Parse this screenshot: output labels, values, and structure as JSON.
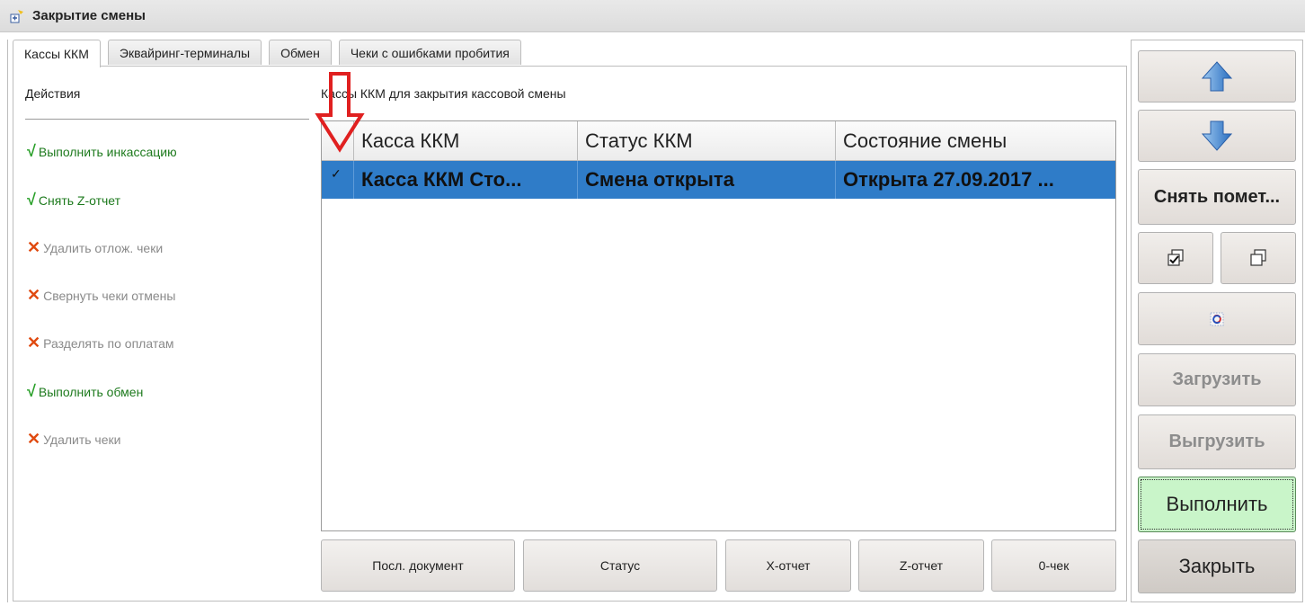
{
  "window": {
    "title": "Закрытие смены"
  },
  "tabs": [
    {
      "label": "Кассы ККМ",
      "active": true
    },
    {
      "label": "Эквайринг-терминалы",
      "active": false
    },
    {
      "label": "Обмен",
      "active": false
    },
    {
      "label": "Чеки с ошибками пробития",
      "active": false
    }
  ],
  "actions": {
    "title": "Действия",
    "items": [
      {
        "label": "Выполнить инкассацию",
        "enabled": true,
        "mark": "√"
      },
      {
        "label": "Снять Z-отчет",
        "enabled": true,
        "mark": "√"
      },
      {
        "label": "Удалить отлож. чеки",
        "enabled": false,
        "mark": "✕"
      },
      {
        "label": "Свернуть чеки отмены",
        "enabled": false,
        "mark": "✕"
      },
      {
        "label": "Разделять по оплатам",
        "enabled": false,
        "mark": "✕"
      },
      {
        "label": "Выполнить обмен",
        "enabled": true,
        "mark": "√"
      },
      {
        "label": "Удалить чеки",
        "enabled": false,
        "mark": "✕"
      }
    ]
  },
  "table": {
    "caption": "Кассы ККМ для закрытия кассовой смены",
    "columns": [
      "",
      "Касса ККМ",
      "Статус ККМ",
      "Состояние смены"
    ],
    "rows": [
      {
        "checked": "✓",
        "kassa": "Касса ККМ Сто...",
        "status": "Смена открыта",
        "state": "Открыта 27.09.2017 ..."
      }
    ]
  },
  "bottom_buttons": {
    "last_doc": "Посл. документ",
    "status": "Статус",
    "x_report": "X-отчет",
    "z_report": "Z-отчет",
    "zero_check": "0-чек"
  },
  "right_buttons": {
    "clear_marks": "Снять помет...",
    "load": "Загрузить",
    "unload": "Выгрузить",
    "execute": "Выполнить",
    "close": "Закрыть"
  },
  "colors": {
    "selection": "#2f7cc8",
    "ok_mark": "#2aa02a",
    "off_mark": "#e04a10",
    "arrow": "#e02020",
    "execute_bg": "#c9f5c9"
  }
}
